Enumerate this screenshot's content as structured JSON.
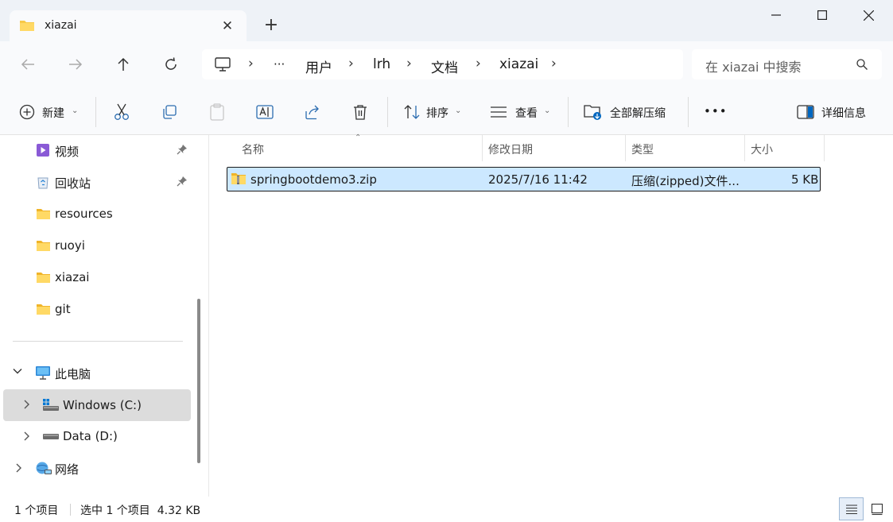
{
  "window": {
    "tab_title": "xiazai",
    "tab_close": "✕",
    "new_tab": "+"
  },
  "breadcrumb": [
    "用户",
    "lrh",
    "文档",
    "xiazai"
  ],
  "breadcrumb_overflow": "···",
  "search": {
    "placeholder": "在 xiazai 中搜索"
  },
  "toolbar": {
    "new_label": "新建",
    "sort_label": "排序",
    "view_label": "查看",
    "extract_label": "全部解压缩",
    "more_label": "•••",
    "details_label": "详细信息"
  },
  "sidebar": {
    "items": [
      {
        "label": "视频",
        "icon": "video-folder-icon",
        "pinned": true
      },
      {
        "label": "回收站",
        "icon": "recycle-bin-icon",
        "pinned": true
      },
      {
        "label": "resources",
        "icon": "folder-icon"
      },
      {
        "label": "ruoyi",
        "icon": "folder-icon"
      },
      {
        "label": "xiazai",
        "icon": "folder-icon"
      },
      {
        "label": "git",
        "icon": "folder-icon"
      }
    ],
    "this_pc": "此电脑",
    "drives": [
      {
        "label": "Windows (C:)",
        "selected": true
      },
      {
        "label": "Data (D:)"
      }
    ],
    "network": "网络"
  },
  "columns": {
    "name": "名称",
    "modified": "修改日期",
    "type": "类型",
    "size": "大小"
  },
  "files": [
    {
      "name": "springbootdemo3.zip",
      "modified": "2025/7/16 11:42",
      "type": "压缩(zipped)文件...",
      "size": "5 KB",
      "selected": true
    }
  ],
  "status": {
    "count": "1 个项目",
    "selection": "选中 1 个项目  4.32 KB"
  },
  "colors": {
    "accent": "#0067c0",
    "selection": "#cce8ff",
    "titlebar": "#eef2f7",
    "folder": "#f7c948"
  }
}
